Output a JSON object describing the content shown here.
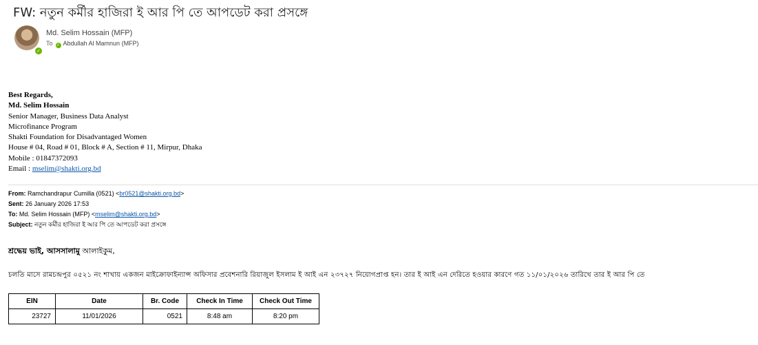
{
  "email": {
    "subject": "FW: নতুন কর্মীর  হাজিরা ই আর পি তে আপডেট করা প্রসঙ্গে",
    "sender_name": "Md. Selim Hossain (MFP)",
    "to_label": "To",
    "recipient": "Abdullah Al Mamnun (MFP)"
  },
  "signature": {
    "regards": "Best Regards,",
    "name": "Md. Selim Hossain",
    "lines": [
      "Senior Manager, Business Data Analyst",
      "Microfinance  Program",
      "Shakti Foundation for Disadvantaged Women",
      "House # 04, Road # 01, Block # A, Section # 11, Mirpur, Dhaka",
      "Mobile : 01847372093"
    ],
    "email_label": "Email : ",
    "email": "mselim@shakti.org.bd"
  },
  "forwarded": {
    "from_label": "From:",
    "from_name": "Ramchandrapur Cumilla (0521) <",
    "from_email": "br0521@shakti.org.bd",
    "from_close": ">",
    "sent_label": "Sent:",
    "sent": "26 January 2026 17:53",
    "to_label": "To:",
    "to_name": "Md. Selim Hossain (MFP) <",
    "to_email": "mselim@shakti.org.bd",
    "to_close": ">",
    "subject_label": "Subject:",
    "subject": "নতুন কর্মীর হাজিরা ই আর পি তে আপডেট করা প্রসঙ্গে"
  },
  "body": {
    "greeting_bold": "শ্রদ্ধেয় ভাই, আসসালামু",
    "greeting_rest": " আলাইকুম,",
    "paragraph": "চলতি মাসে রামচন্দ্রপুর ০৫২১ নং শাখায় একজন  মাইক্রোফাইন্যান্স অফিসার প্রবেশনারি  রিয়াজুল ইসলাম ই আই এন ২৩৭২৭  নিয়োগপ্রাপ্ত হন।  তার ই আই এন দেরিতে হওয়ার কারণে গত ১১/০১/২০২৬ তারিখে  তার ই আর পি তে"
  },
  "table": {
    "headers": [
      "EIN",
      "Date",
      "Br. Code",
      "Check In Time",
      "Check Out Time"
    ],
    "rows": [
      [
        "23727",
        "11/01/2026",
        "0521",
        "8:48 am",
        "8:20 pm"
      ]
    ]
  },
  "colors": {
    "link": "#0b55a8",
    "presence": "#6bb700"
  }
}
